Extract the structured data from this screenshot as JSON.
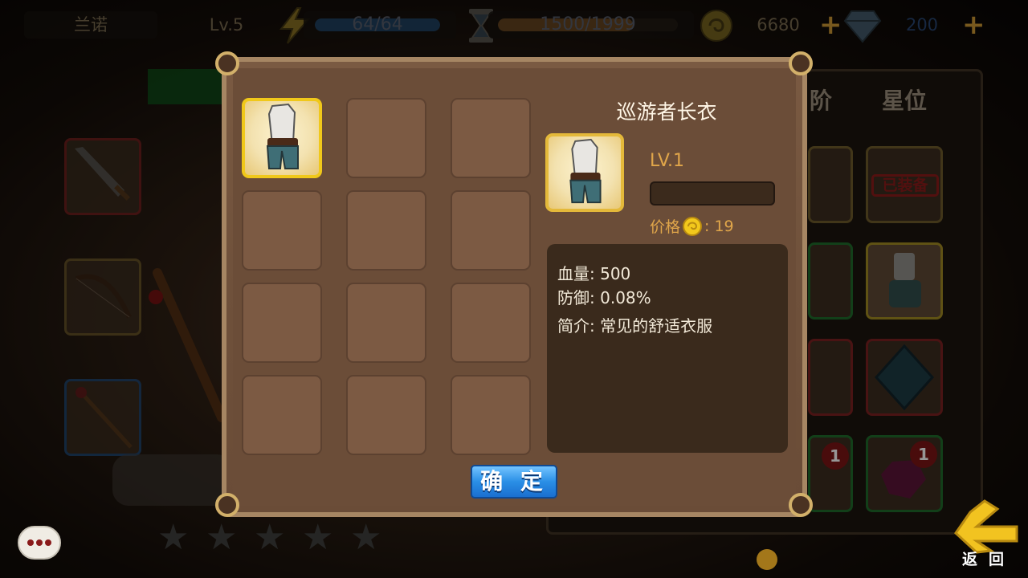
{
  "top_bar": {
    "player_name": "兰诺",
    "level": "Lv.5",
    "energy": "64/64",
    "energy_progress": 1.0,
    "timer_value": "1500/1999",
    "timer_progress": 0.75,
    "gold": "6680",
    "diamonds": "200",
    "add_gold_icon": "plus-icon",
    "add_diamond_icon": "plus-icon"
  },
  "right_panel": {
    "tabs": [
      "阶",
      "星位"
    ],
    "equipped_badge": "已装备",
    "gem_count_1": "1",
    "gem_count_2": "1"
  },
  "stars": {
    "count": 5,
    "filled": 0
  },
  "dialog": {
    "grid_slots": 12,
    "selected_slot": 0,
    "item": {
      "name": "巡游者长衣",
      "level": "LV.1",
      "price_label": "价格",
      "price_value": ": 19",
      "stats": [
        {
          "label": "血量:",
          "value": "500"
        },
        {
          "label": "防御:",
          "value": "0.08%"
        },
        {
          "label": "简介:",
          "value": "常见的舒适衣服"
        }
      ]
    },
    "confirm_label": "确 定"
  },
  "bottom": {
    "back_label": "返回"
  },
  "colors": {
    "dialog_bg": "#6f513b",
    "dialog_border": "#a68663",
    "selected_border": "#f0c81a",
    "confirm_blue": "#2a8fe6",
    "gold_text": "#e0a64a"
  }
}
